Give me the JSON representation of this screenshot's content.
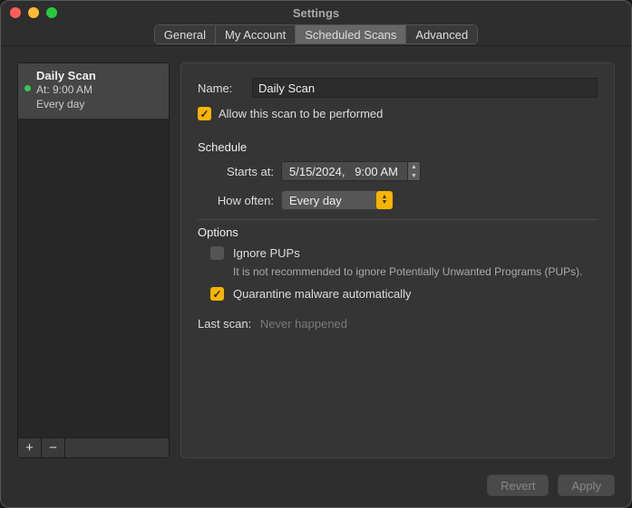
{
  "window": {
    "title": "Settings"
  },
  "tabs": [
    {
      "label": "General"
    },
    {
      "label": "My Account"
    },
    {
      "label": "Scheduled Scans"
    },
    {
      "label": "Advanced"
    }
  ],
  "activeTabIndex": 2,
  "sidebar": {
    "items": [
      {
        "name": "Daily Scan",
        "at_label": "At: 9:00 AM",
        "freq": "Every day",
        "active": true
      }
    ],
    "add_label": "+",
    "remove_label": "−"
  },
  "detail": {
    "name_label": "Name:",
    "name_value": "Daily Scan",
    "allow_label": "Allow this scan to be performed",
    "allow_checked": true,
    "schedule_title": "Schedule",
    "starts_at_label": "Starts at:",
    "starts_at_value": "5/15/2024,   9:00 AM",
    "how_often_label": "How often:",
    "how_often_value": "Every day",
    "options_title": "Options",
    "ignore_pups_label": "Ignore PUPs",
    "ignore_pups_checked": false,
    "ignore_pups_hint": "It is not recommended to ignore Potentially Unwanted Programs (PUPs).",
    "quarantine_label": "Quarantine malware automatically",
    "quarantine_checked": true,
    "last_scan_label": "Last scan:",
    "last_scan_value": "Never happened"
  },
  "footer": {
    "revert": "Revert",
    "apply": "Apply"
  },
  "colors": {
    "accent": "#f7b500"
  }
}
